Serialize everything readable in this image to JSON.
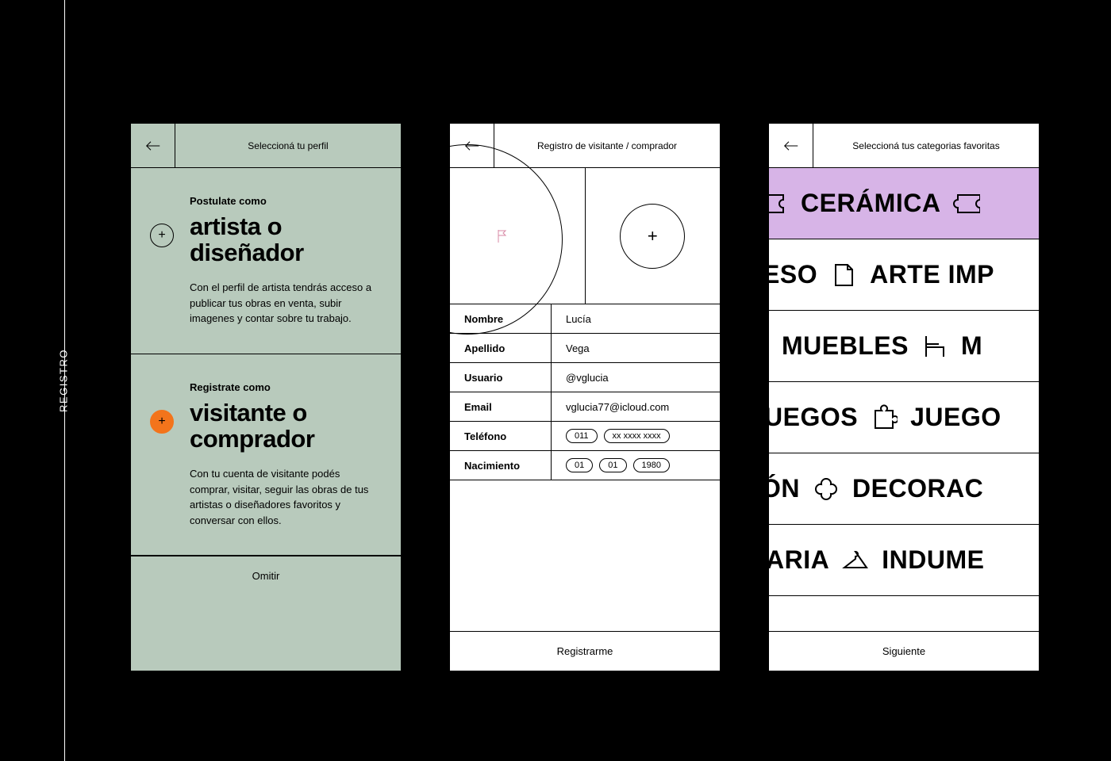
{
  "page_label": "REGISTRO",
  "screens": {
    "profile": {
      "title": "Seleccioná tu perfil",
      "options": [
        {
          "eyebrow": "Postulate como",
          "heading": "artista o diseñador",
          "desc": "Con el perfil de artista tendrás acceso a publicar tus obras en venta, subir imagenes y contar sobre tu trabajo."
        },
        {
          "eyebrow": "Registrate como",
          "heading": "visitante o comprador",
          "desc": "Con tu cuenta de visitante podés comprar, visitar, seguir las obras de tus artistas o diseñadores favoritos y conversar con ellos."
        }
      ],
      "footer": "Omitir"
    },
    "register": {
      "title": "Registro de visitante / comprador",
      "fields": {
        "nombre_label": "Nombre",
        "nombre_value": "Lucía",
        "apellido_label": "Apellido",
        "apellido_value": "Vega",
        "usuario_label": "Usuario",
        "usuario_value": "@vglucia",
        "email_label": "Email",
        "email_value": "vglucia77@icloud.com",
        "telefono_label": "Teléfono",
        "telefono_area": "011",
        "telefono_ph": "xx xxxx xxxx",
        "nacimiento_label": "Nacimiento",
        "nacimiento_d": "01",
        "nacimiento_m": "01",
        "nacimiento_y": "1980"
      },
      "footer": "Registrarme"
    },
    "categories": {
      "title": "Seleccioná tus categorias favoritas",
      "rows": {
        "ceramica": "CERÁMICA",
        "eso": "ESO",
        "arte": "ARTE IMP",
        "muebles": "MUEBLES",
        "m2": "M",
        "juegos_a": "UEGOS",
        "juegos_b": "JUEGO",
        "on": "ÓN",
        "decorac": "DECORAC",
        "aria": "ARIA",
        "indume": "INDUME"
      },
      "footer": "Siguiente"
    }
  }
}
